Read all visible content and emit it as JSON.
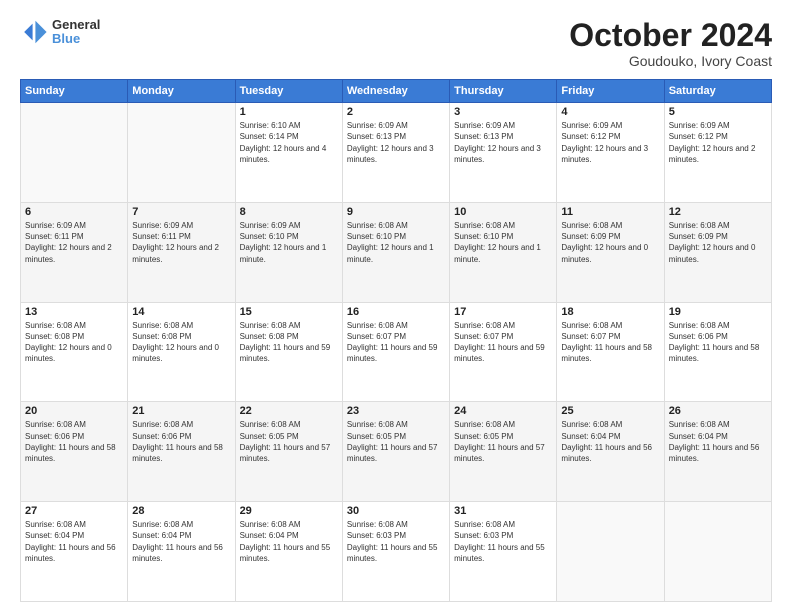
{
  "header": {
    "logo": {
      "line1": "General",
      "line2": "Blue"
    },
    "title": "October 2024",
    "subtitle": "Goudouko, Ivory Coast"
  },
  "weekdays": [
    "Sunday",
    "Monday",
    "Tuesday",
    "Wednesday",
    "Thursday",
    "Friday",
    "Saturday"
  ],
  "weeks": [
    [
      {
        "day": "",
        "info": ""
      },
      {
        "day": "",
        "info": ""
      },
      {
        "day": "1",
        "info": "Sunrise: 6:10 AM\nSunset: 6:14 PM\nDaylight: 12 hours and 4 minutes."
      },
      {
        "day": "2",
        "info": "Sunrise: 6:09 AM\nSunset: 6:13 PM\nDaylight: 12 hours and 3 minutes."
      },
      {
        "day": "3",
        "info": "Sunrise: 6:09 AM\nSunset: 6:13 PM\nDaylight: 12 hours and 3 minutes."
      },
      {
        "day": "4",
        "info": "Sunrise: 6:09 AM\nSunset: 6:12 PM\nDaylight: 12 hours and 3 minutes."
      },
      {
        "day": "5",
        "info": "Sunrise: 6:09 AM\nSunset: 6:12 PM\nDaylight: 12 hours and 2 minutes."
      }
    ],
    [
      {
        "day": "6",
        "info": "Sunrise: 6:09 AM\nSunset: 6:11 PM\nDaylight: 12 hours and 2 minutes."
      },
      {
        "day": "7",
        "info": "Sunrise: 6:09 AM\nSunset: 6:11 PM\nDaylight: 12 hours and 2 minutes."
      },
      {
        "day": "8",
        "info": "Sunrise: 6:09 AM\nSunset: 6:10 PM\nDaylight: 12 hours and 1 minute."
      },
      {
        "day": "9",
        "info": "Sunrise: 6:08 AM\nSunset: 6:10 PM\nDaylight: 12 hours and 1 minute."
      },
      {
        "day": "10",
        "info": "Sunrise: 6:08 AM\nSunset: 6:10 PM\nDaylight: 12 hours and 1 minute."
      },
      {
        "day": "11",
        "info": "Sunrise: 6:08 AM\nSunset: 6:09 PM\nDaylight: 12 hours and 0 minutes."
      },
      {
        "day": "12",
        "info": "Sunrise: 6:08 AM\nSunset: 6:09 PM\nDaylight: 12 hours and 0 minutes."
      }
    ],
    [
      {
        "day": "13",
        "info": "Sunrise: 6:08 AM\nSunset: 6:08 PM\nDaylight: 12 hours and 0 minutes."
      },
      {
        "day": "14",
        "info": "Sunrise: 6:08 AM\nSunset: 6:08 PM\nDaylight: 12 hours and 0 minutes."
      },
      {
        "day": "15",
        "info": "Sunrise: 6:08 AM\nSunset: 6:08 PM\nDaylight: 11 hours and 59 minutes."
      },
      {
        "day": "16",
        "info": "Sunrise: 6:08 AM\nSunset: 6:07 PM\nDaylight: 11 hours and 59 minutes."
      },
      {
        "day": "17",
        "info": "Sunrise: 6:08 AM\nSunset: 6:07 PM\nDaylight: 11 hours and 59 minutes."
      },
      {
        "day": "18",
        "info": "Sunrise: 6:08 AM\nSunset: 6:07 PM\nDaylight: 11 hours and 58 minutes."
      },
      {
        "day": "19",
        "info": "Sunrise: 6:08 AM\nSunset: 6:06 PM\nDaylight: 11 hours and 58 minutes."
      }
    ],
    [
      {
        "day": "20",
        "info": "Sunrise: 6:08 AM\nSunset: 6:06 PM\nDaylight: 11 hours and 58 minutes."
      },
      {
        "day": "21",
        "info": "Sunrise: 6:08 AM\nSunset: 6:06 PM\nDaylight: 11 hours and 58 minutes."
      },
      {
        "day": "22",
        "info": "Sunrise: 6:08 AM\nSunset: 6:05 PM\nDaylight: 11 hours and 57 minutes."
      },
      {
        "day": "23",
        "info": "Sunrise: 6:08 AM\nSunset: 6:05 PM\nDaylight: 11 hours and 57 minutes."
      },
      {
        "day": "24",
        "info": "Sunrise: 6:08 AM\nSunset: 6:05 PM\nDaylight: 11 hours and 57 minutes."
      },
      {
        "day": "25",
        "info": "Sunrise: 6:08 AM\nSunset: 6:04 PM\nDaylight: 11 hours and 56 minutes."
      },
      {
        "day": "26",
        "info": "Sunrise: 6:08 AM\nSunset: 6:04 PM\nDaylight: 11 hours and 56 minutes."
      }
    ],
    [
      {
        "day": "27",
        "info": "Sunrise: 6:08 AM\nSunset: 6:04 PM\nDaylight: 11 hours and 56 minutes."
      },
      {
        "day": "28",
        "info": "Sunrise: 6:08 AM\nSunset: 6:04 PM\nDaylight: 11 hours and 56 minutes."
      },
      {
        "day": "29",
        "info": "Sunrise: 6:08 AM\nSunset: 6:04 PM\nDaylight: 11 hours and 55 minutes."
      },
      {
        "day": "30",
        "info": "Sunrise: 6:08 AM\nSunset: 6:03 PM\nDaylight: 11 hours and 55 minutes."
      },
      {
        "day": "31",
        "info": "Sunrise: 6:08 AM\nSunset: 6:03 PM\nDaylight: 11 hours and 55 minutes."
      },
      {
        "day": "",
        "info": ""
      },
      {
        "day": "",
        "info": ""
      }
    ]
  ]
}
